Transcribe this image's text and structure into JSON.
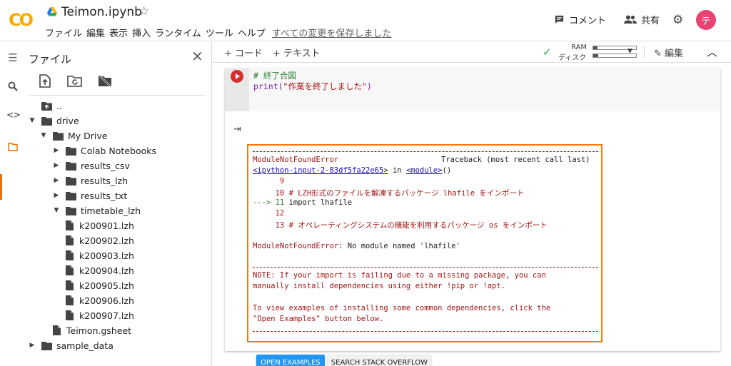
{
  "header": {
    "logo": "CO",
    "doc_title": "Teimon.ipynb",
    "menu": [
      "ファイル",
      "編集",
      "表示",
      "挿入",
      "ランタイム",
      "ツール",
      "ヘルプ"
    ],
    "save_status": "すべての変更を保存しました",
    "comment_label": "コメント",
    "share_label": "共有",
    "avatar_initial": "テ",
    "avatar_color": "#e94374"
  },
  "rail": {
    "icons": [
      "toc-icon",
      "search-icon",
      "code-snippets-icon",
      "folder-icon"
    ],
    "active_color": "#e8710a"
  },
  "files": {
    "title": "ファイル",
    "tree": [
      {
        "label": "..",
        "depth": 0,
        "type": "folder-up",
        "expanded": null
      },
      {
        "label": "drive",
        "depth": 0,
        "type": "folder",
        "expanded": true
      },
      {
        "label": "My Drive",
        "depth": 1,
        "type": "folder",
        "expanded": true
      },
      {
        "label": "Colab Notebooks",
        "depth": 2,
        "type": "folder",
        "expanded": false
      },
      {
        "label": "results_csv",
        "depth": 2,
        "type": "folder",
        "expanded": false
      },
      {
        "label": "results_lzh",
        "depth": 2,
        "type": "folder",
        "expanded": false
      },
      {
        "label": "results_txt",
        "depth": 2,
        "type": "folder",
        "expanded": false
      },
      {
        "label": "timetable_lzh",
        "depth": 2,
        "type": "folder",
        "expanded": true
      },
      {
        "label": "k200901.lzh",
        "depth": 3,
        "type": "file",
        "expanded": null
      },
      {
        "label": "k200902.lzh",
        "depth": 3,
        "type": "file",
        "expanded": null
      },
      {
        "label": "k200903.lzh",
        "depth": 3,
        "type": "file",
        "expanded": null
      },
      {
        "label": "k200904.lzh",
        "depth": 3,
        "type": "file",
        "expanded": null
      },
      {
        "label": "k200905.lzh",
        "depth": 3,
        "type": "file",
        "expanded": null
      },
      {
        "label": "k200906.lzh",
        "depth": 3,
        "type": "file",
        "expanded": null
      },
      {
        "label": "k200907.lzh",
        "depth": 3,
        "type": "file",
        "expanded": null
      },
      {
        "label": "Teimon.gsheet",
        "depth": 2,
        "type": "file",
        "expanded": null
      },
      {
        "label": "sample_data",
        "depth": 0,
        "type": "folder",
        "expanded": false
      }
    ]
  },
  "toolbar": {
    "add_code": "+ コード",
    "add_text": "+ テキスト",
    "ram_label": "RAM",
    "disk_label": "ディスク",
    "ram_usage": 0.1,
    "disk_usage": 0.12,
    "edit_label": "編集"
  },
  "cell": {
    "code_line1": "# 終了合図",
    "code_print": "print(",
    "code_string": "\"作業を終了しました\"",
    "code_close": ")",
    "output": {
      "divider": "---------------------------------------------------------------------------",
      "error_name": "ModuleNotFoundError",
      "traceback_label": "Traceback (most recent call last)",
      "input_link": "<ipython-input-2-83df5fa22e65>",
      "in_text": " in ",
      "module_link": "<module>",
      "module_parens": "()",
      "line9": "      9",
      "line10": "     10 # LZH形式のファイルを解凍するパッケージ lhafile をインポート",
      "line11_arrow": "---> 11 ",
      "line11_code": "import lhafile",
      "line12": "     12",
      "line13": "     13 # オペレーティングシステムの機能を利用するパッケージ os をインポート",
      "error_message_name": "ModuleNotFoundError",
      "error_message": ": No module named 'lhafile'",
      "note1": "NOTE: If your import is failing due to a missing package, you can",
      "note2": "manually install dependencies using either !pip or !apt.",
      "note3": "To view examples of installing some common dependencies, click the",
      "note4": "\"Open Examples\" button below."
    },
    "buttons": {
      "open_examples": "OPEN EXAMPLES",
      "search_so": "SEARCH STACK OVERFLOW"
    }
  }
}
